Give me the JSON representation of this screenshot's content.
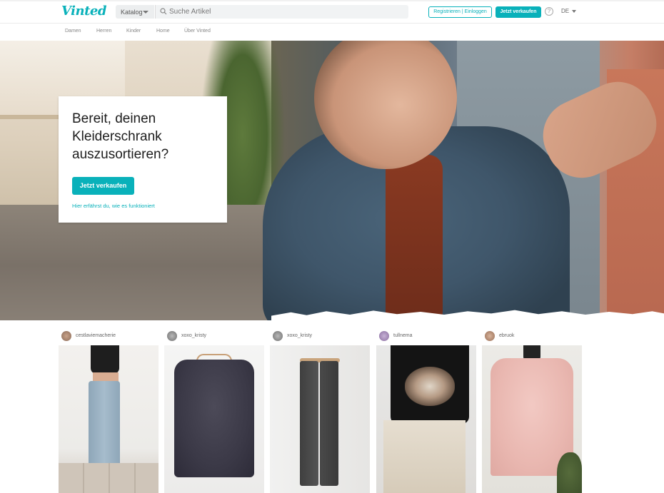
{
  "header": {
    "logo": "Vinted",
    "catalog_label": "Katalog",
    "search_placeholder": "Suche Artikel",
    "register_label": "Registrieren | Einloggen",
    "sell_label": "Jetzt verkaufen",
    "help_glyph": "?",
    "language": "DE"
  },
  "nav": {
    "items": [
      "Damen",
      "Herren",
      "Kinder",
      "Home",
      "Über Vinted"
    ]
  },
  "hero": {
    "headline": "Bereit, deinen Kleiderschrank auszusortieren?",
    "cta_label": "Jetzt verkaufen",
    "how_link": "Hier erfährst du, wie es funktioniert"
  },
  "listings": [
    {
      "username": "cestlaviemacherie"
    },
    {
      "username": "xoxo_kristy"
    },
    {
      "username": "xoxo_kristy"
    },
    {
      "username": "tullnema"
    },
    {
      "username": "ebruok"
    }
  ],
  "colors": {
    "brand": "#09b1ba"
  }
}
